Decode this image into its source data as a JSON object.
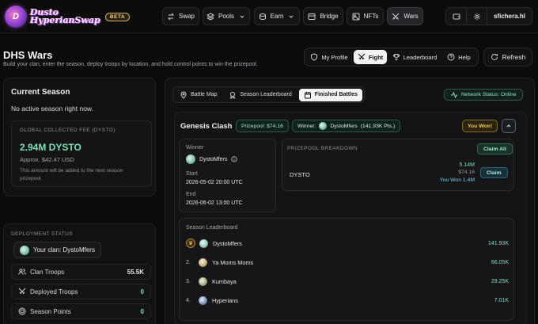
{
  "brand": {
    "name_line1": "Dusto",
    "name_line2": "HyperianSwap",
    "badge": "BETA",
    "logo_mark": "D"
  },
  "nav": [
    {
      "label": "Swap",
      "icon": "swap-icon"
    },
    {
      "label": "Pools",
      "icon": "layers-icon"
    },
    {
      "label": "Earn",
      "icon": "coins-icon"
    },
    {
      "label": "Bridge",
      "icon": "bridge-icon"
    },
    {
      "label": "NFTs",
      "icon": "image-icon"
    },
    {
      "label": "Wars",
      "icon": "swords-icon",
      "active": true
    }
  ],
  "account": {
    "username": "sfichera.hl"
  },
  "header": {
    "title": "DHS Wars",
    "subtitle": "Build your clan, enter the season, deploy troops by location, and hold control points to win the prizepool."
  },
  "main_tabs": [
    {
      "label": "My Profile",
      "icon": "shield-icon"
    },
    {
      "label": "Fight",
      "icon": "swords-icon",
      "active": true
    },
    {
      "label": "Leaderboard",
      "icon": "trophy-icon"
    },
    {
      "label": "Help",
      "icon": "help-icon"
    }
  ],
  "refresh_label": "Refresh",
  "current_season": {
    "title": "Current Season",
    "message": "No active season right now.",
    "fee_label": "GLOBAL COLLECTED FEE (DYSTO)",
    "fee_value": "2.94M DYSTO",
    "fee_usd": "Approx. $42.47 USD",
    "fee_note": "This amount will be added to the next season prizepool."
  },
  "deployment": {
    "label": "DEPLOYMENT STATUS",
    "clan_chip": "Your clan: DystoMfers",
    "stats": [
      {
        "label": "Clan Troops",
        "value": "55.5K",
        "icon": "users-icon"
      },
      {
        "label": "Deployed Troops",
        "value": "0",
        "icon": "deploy-icon"
      },
      {
        "label": "Season Points",
        "value": "0",
        "icon": "target-icon"
      }
    ]
  },
  "sub_tabs": [
    {
      "label": "Battle Map",
      "icon": "map-pin-icon"
    },
    {
      "label": "Season Leaderboard",
      "icon": "medal-icon"
    },
    {
      "label": "Finished Battles",
      "icon": "calendar-icon",
      "active": true
    }
  ],
  "network_status": "Network Status: Online",
  "battle": {
    "name": "Genesis Clash",
    "prizepool_chip": "Prizepool: $74.16",
    "winner_chip_prefix": "Winner:",
    "winner_chip_name": "DystoMfers",
    "winner_chip_pts": "(141.93K Pts.)",
    "won_badge": "You Won!",
    "winner_label": "Winner",
    "winner_name": "DystoMfers",
    "start_label": "Start",
    "start_value": "2026-05-02 20:00 UTC",
    "end_label": "End",
    "end_value": "2026-06-02 13:00 UTC",
    "prize_label": "PRIZEPOOL BREAKDOWN",
    "claim_all": "Claim All",
    "token": "DYSTO",
    "token_amount": "5.14M",
    "token_usd": "$74.16",
    "you_won": "You Won 1.4M",
    "claim": "Claim",
    "leaderboard_title": "Season Leaderboard",
    "leaderboard": [
      {
        "rank": "",
        "name": "DystoMfers",
        "points": "141.93K",
        "color": "#8ec7b8"
      },
      {
        "rank": "2.",
        "name": "Ya Moms Moms",
        "points": "66.05K",
        "color": "#c9a86a"
      },
      {
        "rank": "3.",
        "name": "Kumbaya",
        "points": "29.25K",
        "color": "#a3a37a"
      },
      {
        "rank": "4.",
        "name": "Hyperians",
        "points": "7.01K",
        "color": "#6e8fb8"
      }
    ]
  },
  "colors": {
    "accent_green": "#7fe0b6",
    "gold": "#f1c760",
    "background": "#0b0b0c"
  }
}
